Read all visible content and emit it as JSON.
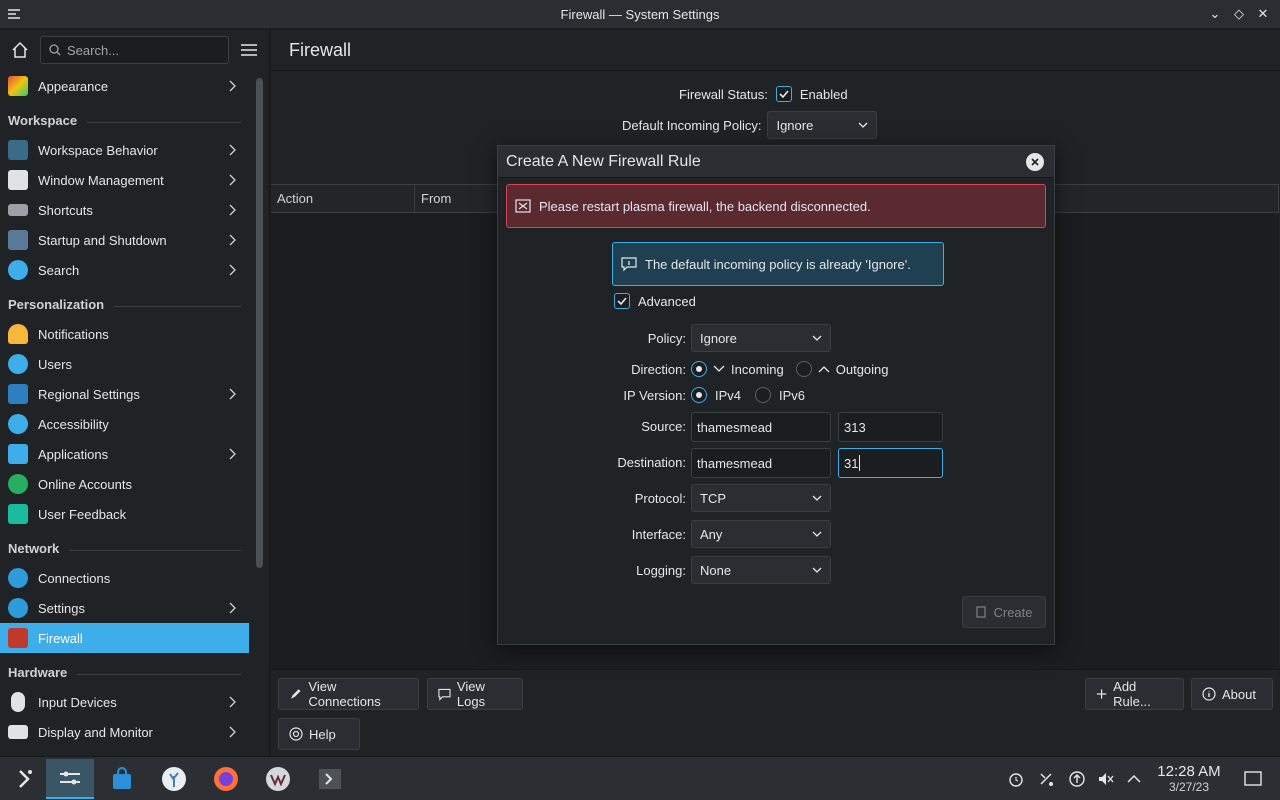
{
  "window": {
    "title": "Firewall — System Settings"
  },
  "search": {
    "placeholder": "Search..."
  },
  "sidebar": {
    "top_items": [
      {
        "label": "Appearance"
      }
    ],
    "sections": [
      {
        "title": "Workspace",
        "items": [
          "Workspace Behavior",
          "Window Management",
          "Shortcuts",
          "Startup and Shutdown",
          "Search"
        ]
      },
      {
        "title": "Personalization",
        "items": [
          "Notifications",
          "Users",
          "Regional Settings",
          "Accessibility",
          "Applications",
          "Online Accounts",
          "User Feedback"
        ]
      },
      {
        "title": "Network",
        "items": [
          "Connections",
          "Settings",
          "Firewall"
        ]
      },
      {
        "title": "Hardware",
        "items": [
          "Input Devices",
          "Display and Monitor"
        ]
      }
    ]
  },
  "main": {
    "title": "Firewall",
    "status_label": "Firewall Status:",
    "status_value": "Enabled",
    "policy_label": "Default Incoming Policy:",
    "policy_value": "Ignore",
    "columns": [
      "Action",
      "From"
    ],
    "buttons": {
      "view_connections": "View Connections",
      "view_logs": "View Logs",
      "add_rule": "Add Rule...",
      "about": "About",
      "help": "Help"
    }
  },
  "dialog": {
    "title": "Create A New Firewall Rule",
    "error": "Please restart plasma firewall, the backend disconnected.",
    "info": "The default incoming policy is already 'Ignore'.",
    "advanced": "Advanced",
    "policy_label": "Policy:",
    "policy_value": "Ignore",
    "direction_label": "Direction:",
    "incoming": "Incoming",
    "outgoing": "Outgoing",
    "ipver_label": "IP Version:",
    "ipv4": "IPv4",
    "ipv6": "IPv6",
    "source_label": "Source:",
    "source_host": "thamesmead",
    "source_port": "313",
    "dest_label": "Destination:",
    "dest_host": "thamesmead",
    "dest_port": "31",
    "protocol_label": "Protocol:",
    "protocol_value": "TCP",
    "interface_label": "Interface:",
    "interface_value": "Any",
    "logging_label": "Logging:",
    "logging_value": "None",
    "create": "Create"
  },
  "taskbar": {
    "time": "12:28 AM",
    "date": "3/27/23"
  },
  "colors": {
    "accent": "#3daee9",
    "error_bg": "#5a2a30",
    "info_bg": "#1f4050"
  }
}
